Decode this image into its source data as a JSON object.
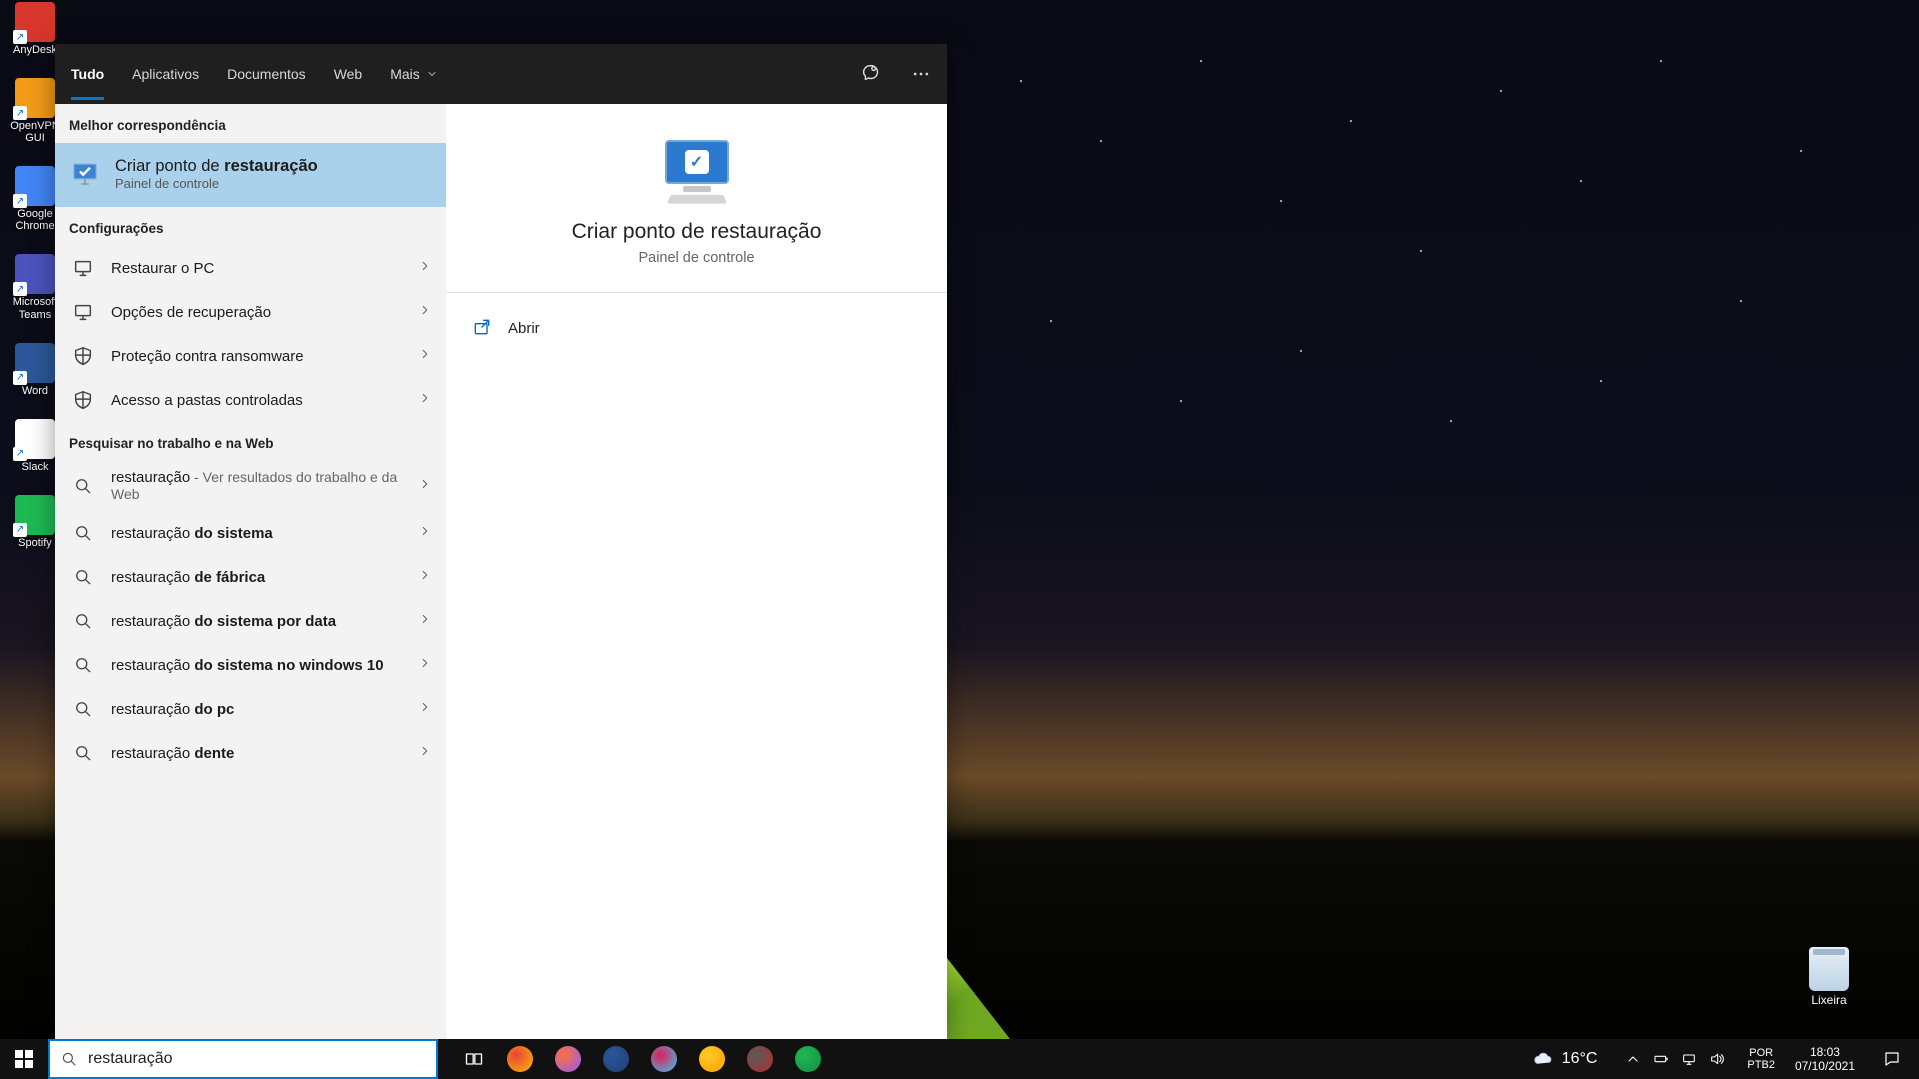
{
  "desktop": {
    "icons": [
      {
        "name": "anydesk",
        "label": "AnyDesk",
        "color": "#d6362b"
      },
      {
        "name": "openvpn",
        "label": "OpenVPN GUI",
        "color": "#f39a16"
      },
      {
        "name": "chrome",
        "label": "Google Chrome",
        "color": "#4285f4"
      },
      {
        "name": "teams",
        "label": "Microsoft Teams",
        "color": "#4b53bc"
      },
      {
        "name": "word",
        "label": "Word",
        "color": "#2b579a"
      },
      {
        "name": "slack",
        "label": "Slack",
        "color": "#ffffff"
      },
      {
        "name": "spotify",
        "label": "Spotify",
        "color": "#1db954"
      }
    ],
    "recycle_label": "Lixeira"
  },
  "search": {
    "tabs": {
      "all": "Tudo",
      "apps": "Aplicativos",
      "docs": "Documentos",
      "web": "Web",
      "more": "Mais"
    },
    "sections": {
      "best": "Melhor correspondência",
      "settings": "Configurações",
      "web": "Pesquisar no trabalho e na Web"
    },
    "best_match": {
      "title_prefix": "Criar ponto de ",
      "title_bold": "restauração",
      "subtitle": "Painel de controle"
    },
    "settings_items": [
      {
        "label": "Restaurar o PC",
        "icon": "pc"
      },
      {
        "label": "Opções de recuperação",
        "icon": "pc"
      },
      {
        "label": "Proteção contra ransomware",
        "icon": "shield"
      },
      {
        "label": "Acesso a pastas controladas",
        "icon": "shield"
      }
    ],
    "web_items": [
      {
        "prefix": "restauração",
        "bold": "",
        "grey": " - Ver resultados do trabalho e da Web"
      },
      {
        "prefix": "restauração ",
        "bold": "do sistema",
        "grey": ""
      },
      {
        "prefix": "restauração ",
        "bold": "de fábrica",
        "grey": ""
      },
      {
        "prefix": "restauração ",
        "bold": "do sistema por data",
        "grey": ""
      },
      {
        "prefix": "restauração ",
        "bold": "do sistema no windows 10",
        "grey": ""
      },
      {
        "prefix": "restauração ",
        "bold": "do pc",
        "grey": ""
      },
      {
        "prefix": "restauração ",
        "bold": "dente",
        "grey": ""
      }
    ],
    "preview": {
      "title": "Criar ponto de restauração",
      "subtitle": "Painel de controle",
      "actions": [
        {
          "label": "Abrir",
          "icon": "open"
        }
      ]
    },
    "query": "restauração"
  },
  "taskbar": {
    "pinned": [
      {
        "name": "chrome",
        "color1": "#ea4335",
        "color2": "#fbbc05"
      },
      {
        "name": "firefox",
        "color1": "#ff7139",
        "color2": "#9059ff"
      },
      {
        "name": "word",
        "color1": "#2b579a",
        "color2": "#1e3f73"
      },
      {
        "name": "slack",
        "color1": "#e01e5a",
        "color2": "#36c5f0"
      },
      {
        "name": "explorer",
        "color1": "#ffca28",
        "color2": "#ffa000"
      },
      {
        "name": "photoscape",
        "color1": "#5a5a5a",
        "color2": "#b02e2e"
      },
      {
        "name": "spotify",
        "color1": "#1db954",
        "color2": "#148f40"
      }
    ],
    "weather_temp": "16°C",
    "lang1": "POR",
    "lang2": "PTB2",
    "time": "18:03",
    "date": "07/10/2021"
  }
}
